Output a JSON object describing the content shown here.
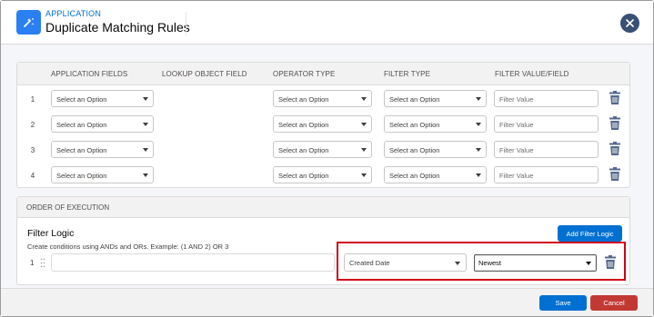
{
  "header": {
    "app_label": "APPLICATION",
    "title": "Duplicate Matching Rules",
    "app_icon": "rules-icon",
    "close_icon": "close-icon"
  },
  "table": {
    "columns": [
      "APPLICATION FIELDS",
      "LOOKUP OBJECT FIELD",
      "OPERATOR TYPE",
      "FILTER TYPE",
      "FILTER VALUE/FIELD"
    ],
    "rows": [
      {
        "num": "1",
        "app_field": "Select an Option",
        "operator": "Select an Option",
        "filter_type": "Select an Option",
        "filter_value_placeholder": "Filter Value"
      },
      {
        "num": "2",
        "app_field": "Select an Option",
        "operator": "Select an Option",
        "filter_type": "Select an Option",
        "filter_value_placeholder": "Filter Value"
      },
      {
        "num": "3",
        "app_field": "Select an Option",
        "operator": "Select an Option",
        "filter_type": "Select an Option",
        "filter_value_placeholder": "Filter Value"
      },
      {
        "num": "4",
        "app_field": "Select an Option",
        "operator": "Select an Option",
        "filter_type": "Select an Option",
        "filter_value_placeholder": "Filter Value"
      }
    ]
  },
  "execution": {
    "heading": "ORDER OF EXECUTION",
    "filter_logic_title": "Filter Logic",
    "filter_logic_desc": "Create conditions using ANDs and ORs. Example: (1 AND 2) OR 3",
    "add_button": "Add Filter Logic",
    "row_num": "1",
    "sort_field": "Created Date",
    "sort_order": "Newest"
  },
  "footer": {
    "save": "Save",
    "cancel": "Cancel"
  },
  "colors": {
    "brand": "#0070d2",
    "cancel": "#c23934",
    "highlight": "#d0021b"
  }
}
